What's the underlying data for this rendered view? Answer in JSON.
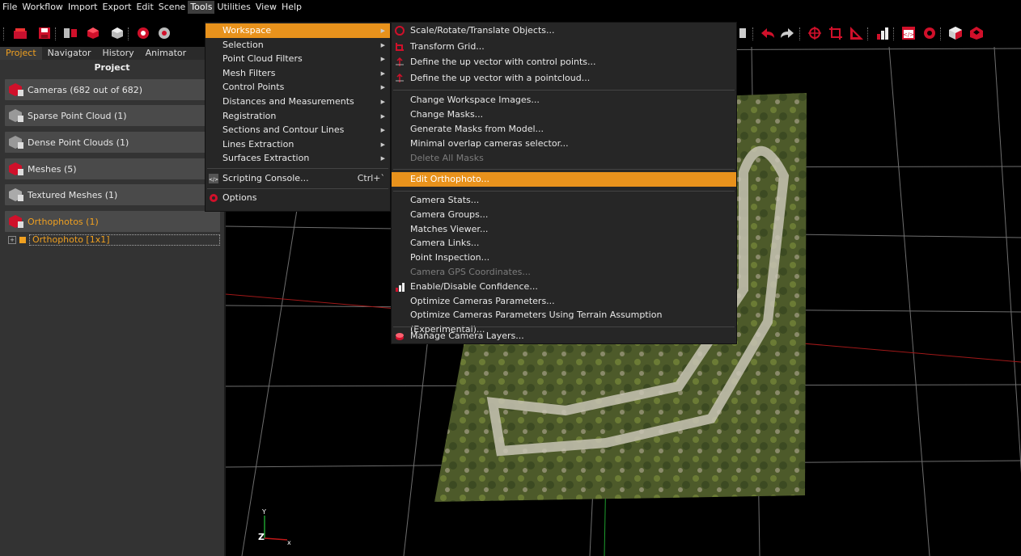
{
  "menubar": [
    "File",
    "Workflow",
    "Import",
    "Export",
    "Edit",
    "Scene",
    "Tools",
    "Utilities",
    "View",
    "Help"
  ],
  "menubar_active": "Tools",
  "toolbar_icons": [
    "new-project-icon",
    "save-icon",
    "workflow-icon",
    "mesh-icon",
    "texture-icon",
    "point-cloud-icon",
    "dense-cloud-icon",
    "measure-icon",
    "undo-icon",
    "redo-icon",
    "rotate-icon",
    "crop-icon",
    "ruler-icon",
    "chart-icon",
    "console-icon",
    "settings-icon",
    "cube-icon",
    "logo-icon"
  ],
  "left_panel": {
    "tabs": [
      "Project",
      "Navigator",
      "History",
      "Animator"
    ],
    "active_tab": "Project",
    "title": "Project",
    "items": [
      {
        "label": "Cameras (682 out of 682)",
        "icon": "cameras-icon",
        "highlight": false
      },
      {
        "label": "Sparse Point Cloud (1)",
        "icon": "sparse-point-cloud-icon",
        "highlight": false
      },
      {
        "label": "Dense Point Clouds (1)",
        "icon": "dense-point-cloud-icon",
        "highlight": false
      },
      {
        "label": "Meshes (5)",
        "icon": "meshes-icon",
        "highlight": false
      },
      {
        "label": "Textured Meshes (1)",
        "icon": "textured-meshes-icon",
        "highlight": false
      },
      {
        "label": "Orthophotos (1)",
        "icon": "orthophotos-icon",
        "highlight": true
      }
    ],
    "tree_item": "Orthophoto [1x1]"
  },
  "tools_menu": {
    "items": [
      {
        "label": "Workspace",
        "submenu": true,
        "highlighted": true
      },
      {
        "label": "Selection",
        "submenu": true
      },
      {
        "label": "Point Cloud Filters",
        "submenu": true
      },
      {
        "label": "Mesh Filters",
        "submenu": true
      },
      {
        "label": "Control Points",
        "submenu": true
      },
      {
        "label": "Distances and Measurements",
        "submenu": true
      },
      {
        "label": "Registration",
        "submenu": true
      },
      {
        "label": "Sections and Contour Lines",
        "submenu": true
      },
      {
        "label": "Lines Extraction",
        "submenu": true
      },
      {
        "label": "Surfaces Extraction",
        "submenu": true
      }
    ],
    "scripting": {
      "label": "Scripting Console...",
      "shortcut": "Ctrl+`"
    },
    "options": {
      "label": "Options"
    }
  },
  "workspace_menu": {
    "group1": [
      {
        "label": "Scale/Rotate/Translate Objects...",
        "icon": "transform-icon"
      },
      {
        "label": "Transform Grid...",
        "icon": "grid-transform-icon"
      },
      {
        "label": "Define the up vector with control points...",
        "icon": "up-vector-icon"
      },
      {
        "label": "Define the up vector with a pointcloud...",
        "icon": "up-vector-cloud-icon"
      }
    ],
    "group2": [
      {
        "label": "Change Workspace Images...",
        "disabled": false
      },
      {
        "label": "Change Masks...",
        "disabled": false
      },
      {
        "label": "Generate Masks from Model...",
        "disabled": false
      },
      {
        "label": "Minimal overlap cameras selector...",
        "disabled": false
      },
      {
        "label": "Delete All Masks",
        "disabled": true
      }
    ],
    "highlighted": "Edit Orthophoto...",
    "group3": [
      {
        "label": "Camera Stats...",
        "disabled": false
      },
      {
        "label": "Camera Groups...",
        "disabled": false
      },
      {
        "label": "Matches Viewer...",
        "disabled": false
      },
      {
        "label": "Camera Links...",
        "disabled": false
      },
      {
        "label": "Point Inspection...",
        "disabled": false
      },
      {
        "label": "Camera GPS Coordinates...",
        "disabled": true
      },
      {
        "label": "Enable/Disable Confidence...",
        "disabled": false,
        "icon": "confidence-icon"
      },
      {
        "label": "Optimize Cameras Parameters...",
        "disabled": false
      },
      {
        "label": "Optimize Cameras Parameters Using Terrain Assumption (Experimental)...",
        "disabled": false
      }
    ],
    "last": {
      "label": "Manage Camera Layers...",
      "icon": "camera-layers-icon"
    }
  },
  "axes": {
    "y": "Y",
    "z": "Z",
    "x": "x"
  },
  "colors": {
    "accent": "#e8921c",
    "orange_text": "#f0a020",
    "panel": "#333333",
    "menu_bg": "#262626"
  }
}
